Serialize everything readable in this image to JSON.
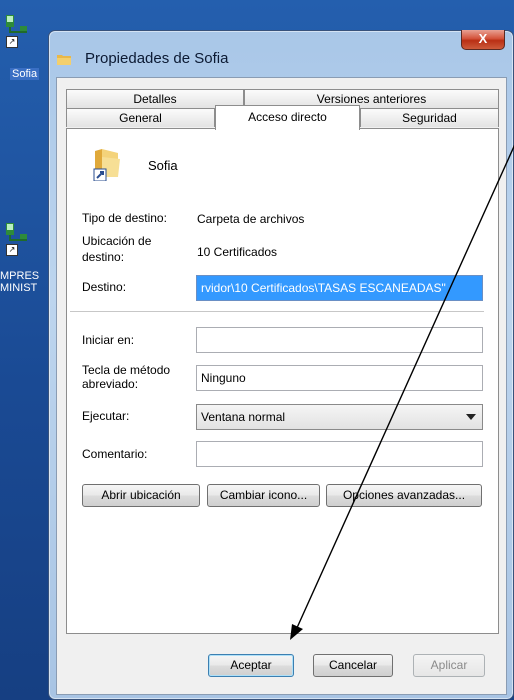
{
  "desktop": {
    "icon1_label": "Sofia",
    "icon2_label_line1": "MPRES",
    "icon2_label_line2": "MINIST"
  },
  "window": {
    "title": "Propiedades de Sofia",
    "close_label": "X"
  },
  "tabs": {
    "detalles": "Detalles",
    "versiones": "Versiones anteriores",
    "general": "General",
    "acceso": "Acceso directo",
    "seguridad": "Seguridad"
  },
  "shortcut": {
    "name": "Sofia",
    "target_type_label": "Tipo de destino:",
    "target_type_value": "Carpeta de archivos",
    "target_location_label_1": "Ubicación de",
    "target_location_label_2": "destino:",
    "target_location_value": "10 Certificados",
    "target_label": "Destino:",
    "target_value": "rvidor\\10 Certificados\\TASAS ESCANEADAS\"",
    "start_in_label": "Iniciar en:",
    "start_in_value": "",
    "hotkey_label_1": "Tecla de método",
    "hotkey_label_2": "abreviado:",
    "hotkey_value": "Ninguno",
    "run_label": "Ejecutar:",
    "run_value": "Ventana normal",
    "comment_label": "Comentario:",
    "comment_value": ""
  },
  "buttons": {
    "open_location": "Abrir ubicación",
    "change_icon": "Cambiar icono...",
    "advanced": "Opciones avanzadas...",
    "ok": "Aceptar",
    "cancel": "Cancelar",
    "apply": "Aplicar"
  },
  "colors": {
    "selection": "#3399ff",
    "close_button": "#c9452a",
    "window_frame": "#a9c7e8"
  }
}
